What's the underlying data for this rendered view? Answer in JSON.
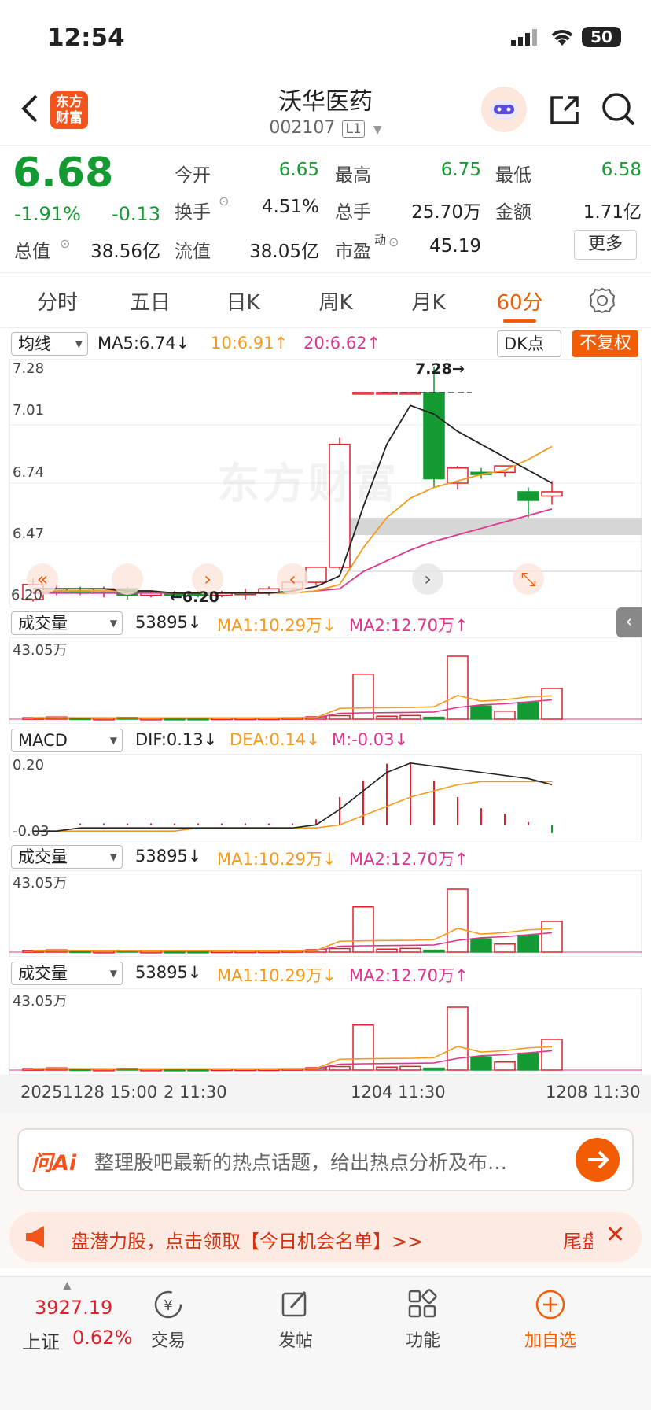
{
  "status_bar": {
    "time": "12:54",
    "battery": "50"
  },
  "header": {
    "name": "沃华医药",
    "code": "002107",
    "level": "L1",
    "logo_line1": "东方",
    "logo_line2": "财富"
  },
  "quote": {
    "price": "6.68",
    "change_pct": "-1.91%",
    "change": "-0.13",
    "rows": [
      [
        {
          "label": "今开",
          "value": "6.65",
          "color": "green"
        },
        {
          "label": "最高",
          "value": "6.75",
          "color": "green"
        },
        {
          "label": "最低",
          "value": "6.58",
          "color": "green"
        }
      ],
      [
        {
          "label": "换手",
          "value": "4.51%",
          "color": "black"
        },
        {
          "label": "总手",
          "value": "25.70万",
          "color": "black"
        },
        {
          "label": "金额",
          "value": "1.71亿",
          "color": "black"
        }
      ]
    ],
    "total_mv_label": "总值",
    "total_mv": "38.56亿",
    "float_mv_label": "流值",
    "float_mv": "38.05亿",
    "pe_label": "市盈",
    "pe_sup": "动",
    "pe": "45.19",
    "more_button": "更多"
  },
  "tabs": [
    {
      "label": "分时",
      "active": false
    },
    {
      "label": "五日",
      "active": false
    },
    {
      "label": "日K",
      "active": false
    },
    {
      "label": "周K",
      "active": false
    },
    {
      "label": "月K",
      "active": false
    },
    {
      "label": "60分",
      "active": true
    }
  ],
  "ma_bar": {
    "selector": "均线",
    "ma5": "MA5:6.74↓",
    "ma10": "10:6.91↑",
    "ma20": "20:6.62↑",
    "dk": "DK点",
    "fq": "不复权"
  },
  "kline": {
    "y_ticks": [
      "7.28",
      "7.01",
      "6.74",
      "6.47",
      "6.20"
    ],
    "high_marker": "7.28→",
    "low_marker": "←6.20",
    "watermark": "东方财富"
  },
  "vol1": {
    "selector": "成交量",
    "val": "53895↓",
    "ma1": "MA1:10.29万↓",
    "ma2": "MA2:12.70万↑",
    "max": "43.05万"
  },
  "macd": {
    "selector": "MACD",
    "dif": "DIF:0.13↓",
    "dea": "DEA:0.14↓",
    "m": "M:-0.03↓",
    "top": "0.20",
    "bottom": "-0.03"
  },
  "vol2": {
    "selector": "成交量",
    "val": "53895↓",
    "ma1": "MA1:10.29万↓",
    "ma2": "MA2:12.70万↑",
    "max": "43.05万"
  },
  "vol3": {
    "selector": "成交量",
    "val": "53895↓",
    "ma1": "MA1:10.29万↓",
    "ma2": "MA2:12.70万↑",
    "max": "43.05万"
  },
  "time_axis": [
    "20251128 15:00",
    "2 11:30",
    "1204 11:30",
    "1208 11:30"
  ],
  "ai_bar": {
    "brand": "问Ai",
    "prompt": "整理股吧最新的热点话题，给出热点分析及布…"
  },
  "banner": {
    "text": "盘潜力股，点击领取【今日机会名单】>>",
    "tail": "尾盘"
  },
  "bottom_nav": {
    "index_value": "3927.19",
    "index_name": "上证",
    "index_change": "0.62%",
    "items": [
      {
        "label": "交易",
        "icon": "trade-icon"
      },
      {
        "label": "发帖",
        "icon": "post-icon"
      },
      {
        "label": "功能",
        "icon": "function-icon"
      },
      {
        "label": "加自选",
        "icon": "add-watch-icon"
      }
    ]
  },
  "colors": {
    "up": "#e0202a",
    "down": "#159a33",
    "accent": "#f25c05",
    "ma5": "#222222",
    "ma10": "#f59a1c",
    "ma20": "#e0358c"
  },
  "chart_data": {
    "type": "candlestick",
    "interval": "60分",
    "y_range": [
      6.2,
      7.28
    ],
    "candles": [
      {
        "o": 6.2,
        "h": 6.3,
        "l": 6.19,
        "c": 6.27
      },
      {
        "o": 6.24,
        "h": 6.27,
        "l": 6.22,
        "c": 6.25
      },
      {
        "o": 6.24,
        "h": 6.26,
        "l": 6.22,
        "c": 6.23
      },
      {
        "o": 6.23,
        "h": 6.26,
        "l": 6.21,
        "c": 6.25
      },
      {
        "o": 6.25,
        "h": 6.26,
        "l": 6.2,
        "c": 6.22
      },
      {
        "o": 6.22,
        "h": 6.24,
        "l": 6.21,
        "c": 6.23
      },
      {
        "o": 6.23,
        "h": 6.24,
        "l": 6.21,
        "c": 6.22
      },
      {
        "o": 6.23,
        "h": 6.24,
        "l": 6.21,
        "c": 6.22
      },
      {
        "o": 6.22,
        "h": 6.24,
        "l": 6.21,
        "c": 6.23
      },
      {
        "o": 6.23,
        "h": 6.25,
        "l": 6.2,
        "c": 6.23
      },
      {
        "o": 6.23,
        "h": 6.26,
        "l": 6.22,
        "c": 6.25
      },
      {
        "o": 6.25,
        "h": 6.29,
        "l": 6.24,
        "c": 6.28
      },
      {
        "o": 6.28,
        "h": 6.35,
        "l": 6.27,
        "c": 6.35
      },
      {
        "o": 6.35,
        "h": 6.95,
        "l": 6.34,
        "c": 6.92
      },
      {
        "o": 7.16,
        "h": 7.16,
        "l": 7.16,
        "c": 7.16
      },
      {
        "o": 7.16,
        "h": 7.16,
        "l": 7.16,
        "c": 7.16
      },
      {
        "o": 7.16,
        "h": 7.16,
        "l": 7.16,
        "c": 7.16
      },
      {
        "o": 7.16,
        "h": 7.28,
        "l": 6.72,
        "c": 6.76
      },
      {
        "o": 6.74,
        "h": 6.82,
        "l": 6.71,
        "c": 6.81
      },
      {
        "o": 6.79,
        "h": 6.81,
        "l": 6.76,
        "c": 6.78
      },
      {
        "o": 6.79,
        "h": 6.82,
        "l": 6.77,
        "c": 6.82
      },
      {
        "o": 6.7,
        "h": 6.72,
        "l": 6.58,
        "c": 6.66
      },
      {
        "o": 6.68,
        "h": 6.75,
        "l": 6.64,
        "c": 6.7
      }
    ],
    "ma5": [
      6.25,
      6.25,
      6.25,
      6.25,
      6.24,
      6.24,
      6.23,
      6.23,
      6.23,
      6.23,
      6.23,
      6.24,
      6.26,
      6.31,
      6.63,
      6.92,
      7.1,
      7.06,
      6.98,
      6.92,
      6.86,
      6.8,
      6.74
    ],
    "ma10": [
      6.24,
      6.24,
      6.24,
      6.24,
      6.24,
      6.24,
      6.23,
      6.23,
      6.23,
      6.23,
      6.23,
      6.23,
      6.24,
      6.27,
      6.44,
      6.58,
      6.67,
      6.72,
      6.75,
      6.78,
      6.8,
      6.85,
      6.91
    ],
    "ma20": [
      6.23,
      6.23,
      6.23,
      6.23,
      6.23,
      6.23,
      6.23,
      6.23,
      6.23,
      6.23,
      6.23,
      6.23,
      6.24,
      6.25,
      6.33,
      6.38,
      6.43,
      6.47,
      6.5,
      6.53,
      6.56,
      6.59,
      6.62
    ],
    "volume": [
      1.0,
      1.5,
      0.8,
      0.6,
      1.2,
      0.6,
      0.6,
      0.6,
      0.8,
      0.8,
      0.8,
      1.0,
      1.6,
      2.4,
      30.8,
      2.0,
      2.5,
      1.3,
      43.05,
      9.0,
      5.5,
      11.5,
      21.0,
      5.4
    ],
    "vol_ma1": [
      1.0,
      1.1,
      1.0,
      1.0,
      0.9,
      0.9,
      0.9,
      0.9,
      0.9,
      0.9,
      0.9,
      1.0,
      1.1,
      7.4,
      7.7,
      7.9,
      8.0,
      8.5,
      16.2,
      12.3,
      13.3,
      15.2,
      16.0,
      12.5
    ],
    "vol_ma2": [
      0.8,
      0.9,
      0.9,
      0.9,
      0.9,
      0.9,
      0.9,
      0.9,
      0.9,
      0.9,
      0.9,
      0.9,
      1.0,
      4.0,
      4.3,
      4.5,
      4.6,
      4.9,
      8.0,
      9.8,
      10.5,
      11.8,
      13.2,
      12.7
    ],
    "macd_dif": [
      -0.02,
      -0.02,
      -0.01,
      -0.01,
      -0.01,
      -0.01,
      -0.01,
      -0.01,
      -0.01,
      -0.01,
      -0.01,
      -0.01,
      0.0,
      0.05,
      0.11,
      0.17,
      0.2,
      0.19,
      0.18,
      0.17,
      0.16,
      0.15,
      0.13
    ],
    "macd_dea": [
      -0.02,
      -0.02,
      -0.02,
      -0.02,
      -0.02,
      -0.02,
      -0.02,
      -0.01,
      -0.01,
      -0.01,
      -0.01,
      -0.01,
      -0.01,
      0.0,
      0.03,
      0.06,
      0.09,
      0.11,
      0.13,
      0.14,
      0.14,
      0.14,
      0.14
    ],
    "macd_m": [
      0.0,
      0.0,
      0.005,
      0.005,
      0.005,
      0.005,
      0.005,
      0.005,
      0.005,
      0.005,
      0.005,
      0.005,
      0.02,
      0.1,
      0.16,
      0.22,
      0.22,
      0.16,
      0.1,
      0.06,
      0.04,
      0.01,
      -0.03
    ]
  }
}
